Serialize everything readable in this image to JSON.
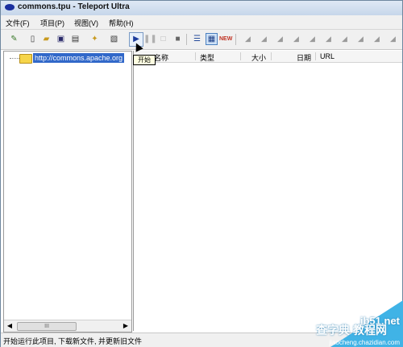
{
  "window": {
    "title": "commons.tpu - Teleport Ultra"
  },
  "menu": {
    "items": [
      {
        "label": "文件(F)"
      },
      {
        "label": "项目(P)"
      },
      {
        "label": "视图(V)"
      },
      {
        "label": "帮助(H)"
      }
    ]
  },
  "toolbar": {
    "tooltip": "开始",
    "icons": [
      "new-project-icon",
      "new-file-icon",
      "open-icon",
      "save-icon",
      "properties-icon",
      "wizard-icon",
      "delete-icon",
      "start-icon",
      "pause-icon",
      "stop-icon",
      "stop-all-icon",
      "list-view-icon",
      "grid-view-icon",
      "new-icon"
    ]
  },
  "tree": {
    "items": [
      {
        "label": "http://commons.apache.org"
      }
    ]
  },
  "file_list": {
    "columns": [
      "名称",
      "类型",
      "大小",
      "日期",
      "URL"
    ]
  },
  "hscroll": {
    "thumb_label": "III"
  },
  "status": {
    "text": "开始运行此项目, 下载新文件, 并更新旧文件"
  },
  "watermark": {
    "site": "jb51.net",
    "name": "查字典 教程网",
    "sub": "jiaocheng.chazidian.com"
  },
  "colors": {
    "selection": "#3168c9",
    "accent": "#40b3e6"
  }
}
